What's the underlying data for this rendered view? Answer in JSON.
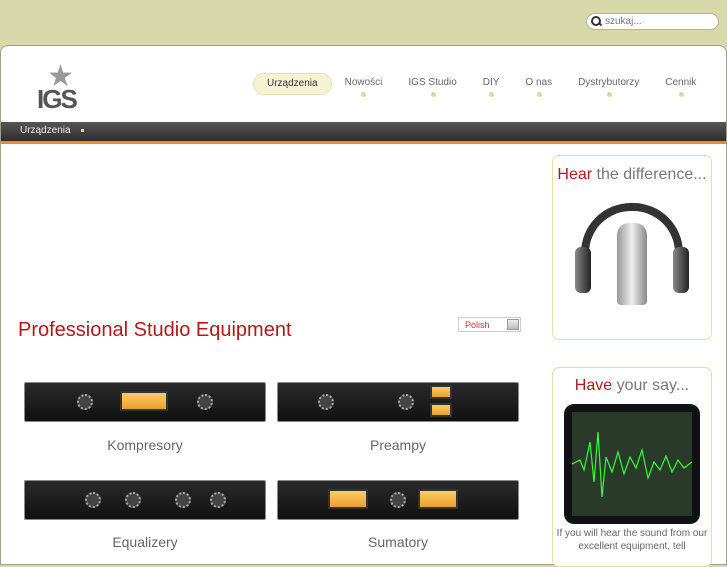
{
  "search": {
    "placeholder": "szukaj..."
  },
  "logo": "IGS",
  "nav": [
    {
      "label": "Urządzenia"
    },
    {
      "label": "Nowości"
    },
    {
      "label": "IGS Studio"
    },
    {
      "label": "DIY"
    },
    {
      "label": "O nas"
    },
    {
      "label": "Dystrybutorzy"
    },
    {
      "label": "Cennik"
    }
  ],
  "breadcrumb": "Urządzenia",
  "main": {
    "title": "Professional Studio Equipment",
    "language": "Polish",
    "products": [
      {
        "label": "Kompresory"
      },
      {
        "label": "Preampy"
      },
      {
        "label": "Equalizery"
      },
      {
        "label": "Sumatory"
      }
    ]
  },
  "sidebar": {
    "hear": {
      "accent": "Hear",
      "rest": " the difference..."
    },
    "say": {
      "accent": "Have",
      "rest": " your say...",
      "text": "If you will hear the sound from our excellent equipment, tell"
    }
  }
}
